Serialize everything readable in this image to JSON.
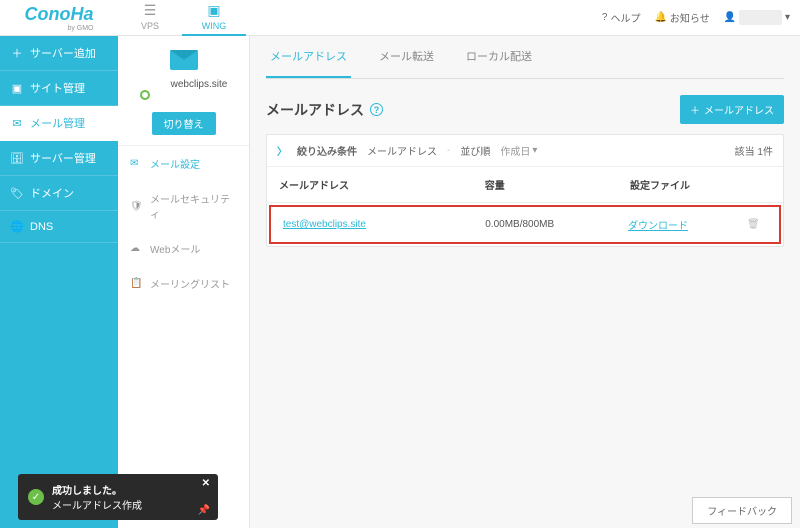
{
  "header": {
    "logo": "ConoHa",
    "logo_sub": "by GMO",
    "tabs": {
      "vps": "VPS",
      "wing": "WING"
    },
    "help": "ヘルプ",
    "notice": "お知らせ"
  },
  "leftnav": {
    "server_add": "サーバー追加",
    "site_mgmt": "サイト管理",
    "mail_mgmt": "メール管理",
    "server_mgmt": "サーバー管理",
    "domain": "ドメイン",
    "dns": "DNS"
  },
  "subnav": {
    "domain_name": "webclips.site",
    "switch": "切り替え",
    "mail_settings": "メール設定",
    "mail_security": "メールセキュリティ",
    "webmail": "Webメール",
    "mailing_list": "メーリングリスト"
  },
  "content_tabs": {
    "addresses": "メールアドレス",
    "forward": "メール転送",
    "local": "ローカル配送"
  },
  "page": {
    "title": "メールアドレス",
    "add_btn": "メールアドレス"
  },
  "panel": {
    "filter_label": "絞り込み条件",
    "filter_field": "メールアドレス",
    "sort_label": "並び順",
    "sort_value": "作成日",
    "count": "該当 1件",
    "col_address": "メールアドレス",
    "col_capacity": "容量",
    "col_file": "設定ファイル",
    "row": {
      "address": "test@webclips.site",
      "capacity": "0.00MB/800MB",
      "file": "ダウンロード"
    }
  },
  "toast": {
    "title": "成功しました。",
    "body": "メールアドレス作成"
  },
  "feedback": "フィードバック"
}
